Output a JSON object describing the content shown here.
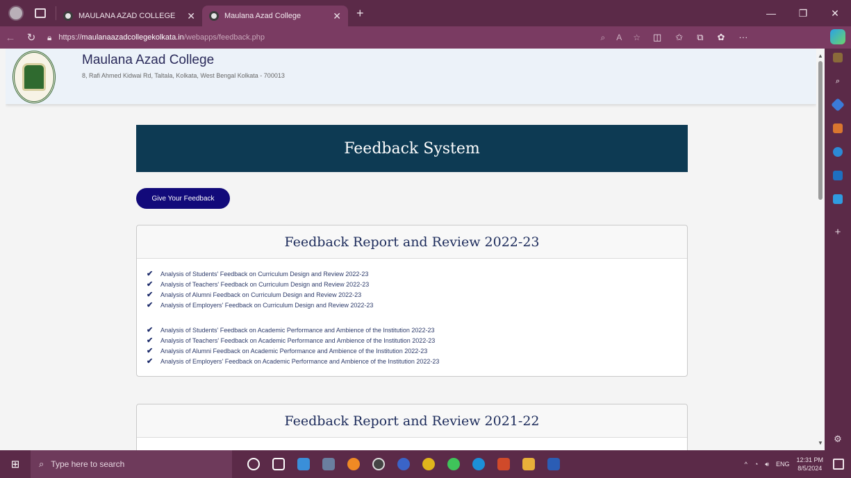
{
  "browser": {
    "tabs": [
      {
        "title": "MAULANA AZAD COLLEGE",
        "active": false
      },
      {
        "title": "Maulana Azad College",
        "active": true
      }
    ],
    "url_prefix": "https://",
    "url_host": "maulanaazadcollegekolkata.in",
    "url_path": "/webapps/feedback.php"
  },
  "site": {
    "name": "Maulana Azad College",
    "address": "8, Rafi Ahmed Kidwai Rd, Taltala, Kolkata, West Bengal Kolkata - 700013"
  },
  "page": {
    "banner_title": "Feedback System",
    "give_feedback_label": "Give Your Feedback"
  },
  "sections": [
    {
      "title": "Feedback Report and Review 2022-23",
      "groups": [
        [
          "Analysis of Students' Feedback on Curriculum Design and Review 2022-23",
          "Analysis of Teachers' Feedback on Curriculum Design and Review 2022-23",
          "Analysis of Alumni Feedback on Curriculum Design and Review 2022-23",
          "Analysis of Employers' Feedback on Curriculum Design and Review 2022-23"
        ],
        [
          "Analysis of Students' Feedback on Academic Performance and Ambience of the Institution 2022-23",
          "Analysis of Teachers' Feedback on Academic Performance and Ambience of the Institution 2022-23",
          "Analysis of Alumni Feedback on Academic Performance and Ambience of the Institution 2022-23",
          "Analysis of Employers' Feedback on Academic Performance and Ambience of the Institution 2022-23"
        ]
      ]
    },
    {
      "title": "Feedback Report and Review 2021-22"
    }
  ],
  "taskbar": {
    "search_placeholder": "Type here to search",
    "language": "ENG",
    "time": "12:31 PM",
    "date": "8/5/2024"
  }
}
